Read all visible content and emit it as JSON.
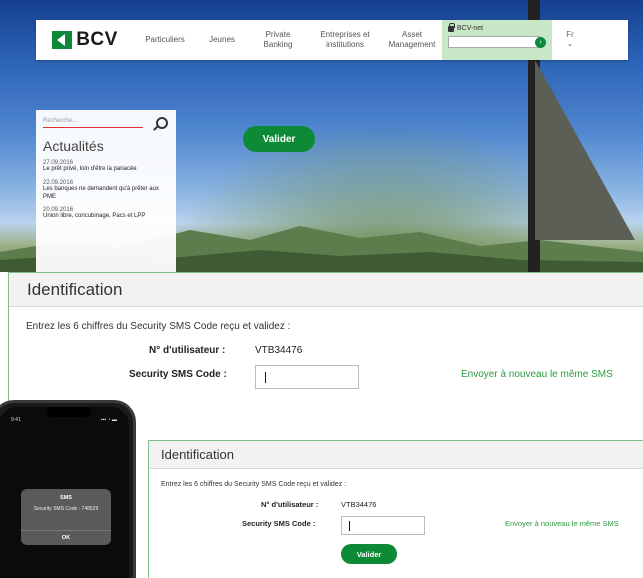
{
  "site": {
    "logo_text": "BCV",
    "nav": [
      {
        "label": "Particuliers"
      },
      {
        "label": "Jeunes"
      },
      {
        "label": "Private\nBanking"
      },
      {
        "label": "Entreprises et\ninstitutions"
      },
      {
        "label": "Asset\nManagement"
      }
    ],
    "bcv_net_label": "BCV-net",
    "bcv_net_go": "›",
    "lang": "Fr",
    "lang_chevron": "⌄",
    "search_placeholder": "Recherche...",
    "news_title": "Actualités",
    "news": [
      {
        "date": "27.09.2016",
        "text": "Le prêt privé, loin d'être la panacée"
      },
      {
        "date": "22.09.2016",
        "text": "Les banques ne demandent qu'à prêter aux PME"
      },
      {
        "date": "20.09.2016",
        "text": "Union libre, concubinage, Pacs et LPP"
      }
    ]
  },
  "identification_large": {
    "title": "Identification",
    "instruction": "Entrez les 6 chiffres du Security SMS Code reçu et validez :",
    "user_label": "N° d'utilisateur :",
    "user_value": "VTB34476",
    "sms_label": "Security SMS Code :",
    "resend_link": "Envoyer à nouveau le même SMS",
    "validate_button": "Valider"
  },
  "identification_small": {
    "title": "Identification",
    "instruction": "Entrez les 6 chiffres du Security SMS Code reçu et validez :",
    "user_label": "N° d'utilisateur :",
    "user_value": "VTB34476",
    "sms_label": "Security SMS Code :",
    "resend_link": "Envoyer à nouveau le même SMS",
    "validate_button": "Valider"
  },
  "phone": {
    "time": "9:41",
    "signal": "▪▪▪ ◔ ▬",
    "sms_title": "SMS",
    "sms_body": "Security SMS Code : 748529",
    "ok_button": "OK"
  },
  "colors": {
    "brand_green": "#0c8a35",
    "link_green": "#2a9a3e",
    "bcv_net_bg": "#c7e7c6"
  }
}
